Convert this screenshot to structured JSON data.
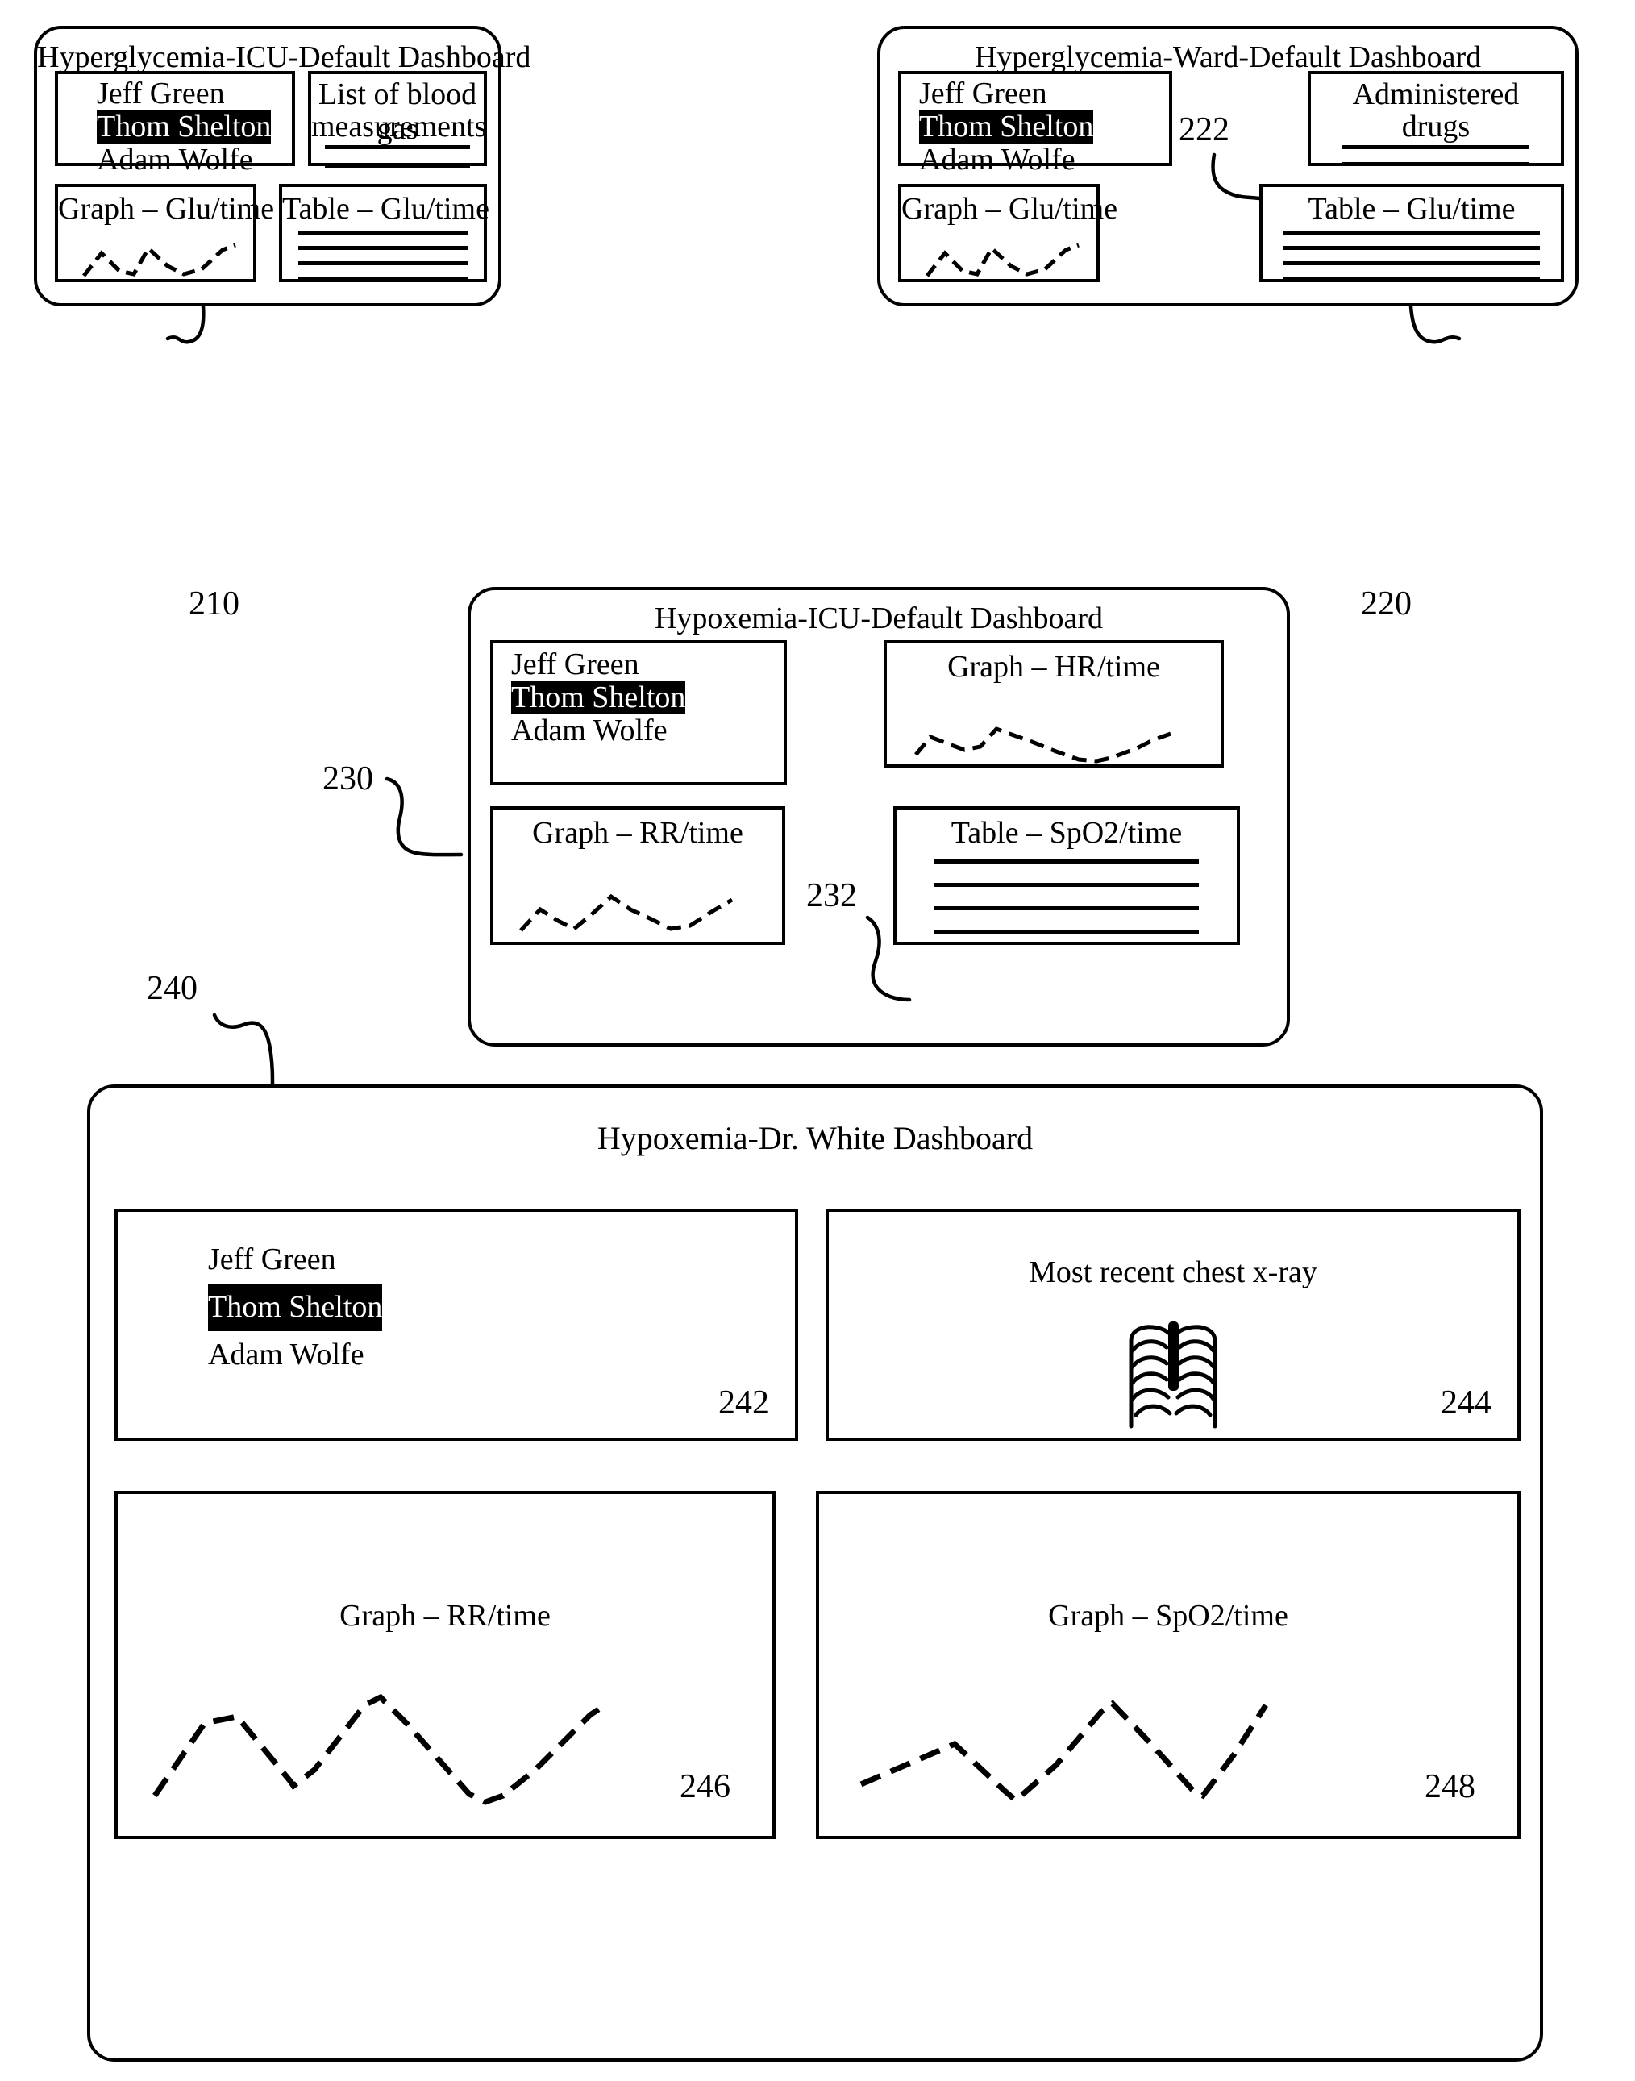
{
  "figure": {
    "type": "patent-diagram",
    "description": "Clinical dashboard configurations"
  },
  "patients": {
    "list": [
      "Jeff Green",
      "Thom Shelton",
      "Adam Wolfe"
    ],
    "selected": "Thom Shelton"
  },
  "dashboards": [
    {
      "ref": "210",
      "title": "Hyperglycemia-ICU-Default Dashboard",
      "widgets": [
        {
          "name": "patient-list",
          "label": ""
        },
        {
          "name": "blood-gas-list",
          "label": "List of blood gas measurements",
          "rules": 2
        },
        {
          "name": "glucose-graph",
          "label": "Graph – Glu/time",
          "sparkline": true
        },
        {
          "name": "glucose-table",
          "label": "Table – Glu/time",
          "rules": 4
        }
      ]
    },
    {
      "ref": "220",
      "title": "Hyperglycemia-Ward-Default Dashboard",
      "widgets": [
        {
          "name": "patient-list",
          "label": ""
        },
        {
          "name": "administered-drugs",
          "label": "Administered drugs",
          "ref": "222",
          "rules": 2
        },
        {
          "name": "glucose-graph",
          "label": "Graph – Glu/time",
          "sparkline": true
        },
        {
          "name": "glucose-table",
          "label": "Table – Glu/time",
          "rules": 4
        }
      ]
    },
    {
      "ref": "230",
      "title": "Hypoxemia-ICU-Default Dashboard",
      "widgets": [
        {
          "name": "patient-list",
          "label": ""
        },
        {
          "name": "hr-graph",
          "label": "Graph – HR/time",
          "sparkline": true
        },
        {
          "name": "rr-graph",
          "label": "Graph – RR/time",
          "sparkline": true
        },
        {
          "name": "spo2-table",
          "label": "Table – SpO2/time",
          "ref": "232",
          "rules": 4
        }
      ]
    },
    {
      "ref": "240",
      "title": "Hypoxemia-Dr. White Dashboard",
      "widgets": [
        {
          "name": "patient-list",
          "label": "",
          "corner": "242"
        },
        {
          "name": "chest-xray",
          "label": "Most recent chest x-ray",
          "corner": "244",
          "icon": "ribcage-icon"
        },
        {
          "name": "rr-graph",
          "label": "Graph – RR/time",
          "corner": "246",
          "sparkline": true
        },
        {
          "name": "spo2-graph",
          "label": "Graph – SpO2/time",
          "corner": "248",
          "sparkline": true
        }
      ]
    }
  ],
  "labels": {
    "ref_210": "210",
    "ref_220": "220",
    "ref_222": "222",
    "ref_230": "230",
    "ref_232": "232",
    "ref_240": "240",
    "ref_242": "242",
    "ref_244": "244",
    "ref_246": "246",
    "ref_248": "248",
    "title_210": "Hyperglycemia-ICU-Default Dashboard",
    "title_220": "Hyperglycemia-Ward-Default Dashboard",
    "title_230": "Hypoxemia-ICU-Default Dashboard",
    "title_240": "Hypoxemia-Dr. White Dashboard",
    "blood_gas": "List of blood gas measurements",
    "blood_gas_l1": "List of blood gas",
    "blood_gas_l2": "measurements",
    "admin_drugs_l1": "Administered",
    "admin_drugs_l2": "drugs",
    "graph_glu": "Graph – Glu/time",
    "table_glu": "Table – Glu/time",
    "graph_hr": "Graph – HR/time",
    "graph_rr": "Graph – RR/time",
    "table_spo2": "Table – SpO2/time",
    "graph_spo2": "Graph – SpO2/time",
    "chest_xray": "Most recent chest x-ray",
    "name_1": "Jeff Green",
    "name_2": "Thom Shelton",
    "name_3": "Adam Wolfe"
  },
  "colors": {
    "stroke": "#000000",
    "background": "#ffffff",
    "selection_bg": "#000000",
    "selection_fg": "#ffffff"
  }
}
